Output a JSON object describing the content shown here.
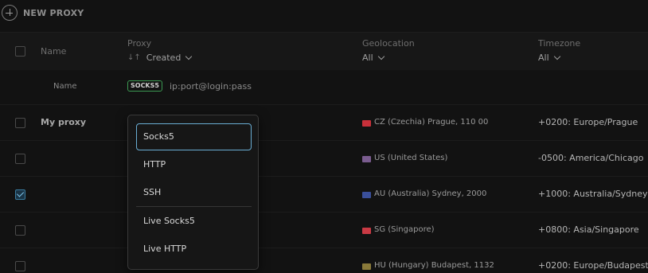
{
  "toolbar": {
    "new_proxy_label": "NEW PROXY"
  },
  "table": {
    "headers": {
      "name": "Name",
      "proxy": "Proxy",
      "sort_label": "Created",
      "geolocation": "Geolocation",
      "geolocation_filter": "All",
      "timezone": "Timezone",
      "timezone_filter": "All"
    },
    "input_row": {
      "name_placeholder": "Name",
      "proxy_type_badge": "SOCKS5",
      "proxy_placeholder": "ip:port@login:pass"
    },
    "rows": [
      {
        "name": "My proxy",
        "checked": false,
        "geo": "CZ (Czechia) Prague, 110 00",
        "tz": "+0200: Europe/Prague",
        "flag_color": "#c8303a"
      },
      {
        "name": "",
        "checked": false,
        "geo": "US (United States)",
        "tz": "-0500: America/Chicago",
        "flag_color": "#7a5c8f"
      },
      {
        "name": "",
        "checked": true,
        "geo": "AU (Australia) Sydney, 2000",
        "tz": "+1000: Australia/Sydney",
        "flag_color": "#3a4f9a"
      },
      {
        "name": "",
        "checked": false,
        "geo": "SG (Singapore)",
        "tz": "+0800: Asia/Singapore",
        "flag_color": "#c93a44"
      },
      {
        "name": "",
        "checked": false,
        "geo": "HU (Hungary) Budapest, 1132",
        "tz": "+0200: Europe/Budapest",
        "flag_color": "#8a7a3a"
      }
    ]
  },
  "dropdown": {
    "options": [
      "Socks5",
      "HTTP",
      "SSH",
      "Live Socks5",
      "Live HTTP"
    ],
    "selected_index": 0
  },
  "colors": {
    "accent": "#6aaed4",
    "badge_border": "#3c9a52",
    "background": "#121212"
  }
}
